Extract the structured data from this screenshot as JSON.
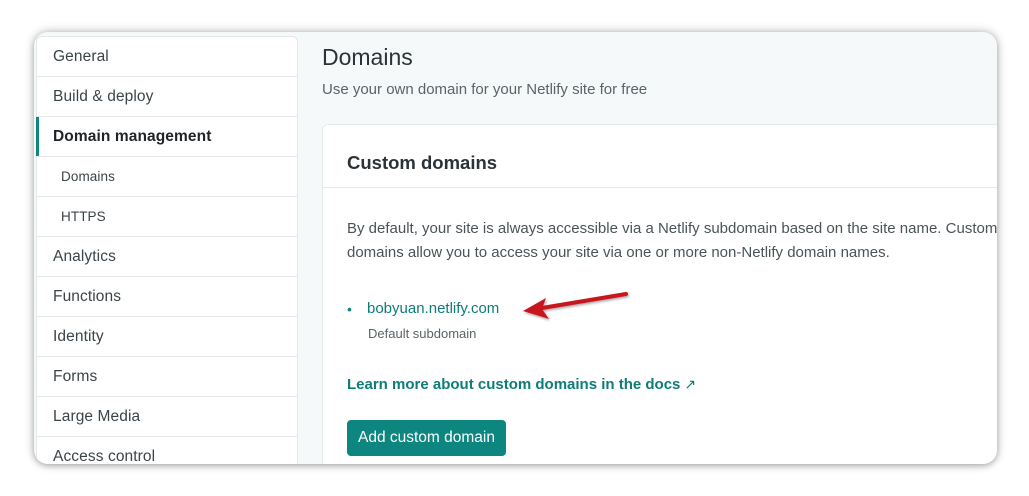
{
  "sidebar": {
    "items": [
      {
        "label": "General"
      },
      {
        "label": "Build & deploy"
      },
      {
        "label": "Domain management"
      },
      {
        "label": "Domains"
      },
      {
        "label": "HTTPS"
      },
      {
        "label": "Analytics"
      },
      {
        "label": "Functions"
      },
      {
        "label": "Identity"
      },
      {
        "label": "Forms"
      },
      {
        "label": "Large Media"
      },
      {
        "label": "Access control"
      }
    ]
  },
  "main": {
    "title": "Domains",
    "subtitle": "Use your own domain for your Netlify site for free",
    "card": {
      "title": "Custom domains",
      "description": "By default, your site is always accessible via a Netlify subdomain based on the site name. Custom domains allow you to access your site via one or more non-Netlify domain names.",
      "bullet": "•",
      "domain": "bobyuan.netlify.com",
      "domain_note": "Default subdomain",
      "docs_link": "Learn more about custom domains in the docs",
      "docs_icon": "↗",
      "add_button": "Add custom domain"
    }
  },
  "colors": {
    "accent": "#0d867f",
    "annotation_arrow": "#c8191f"
  }
}
